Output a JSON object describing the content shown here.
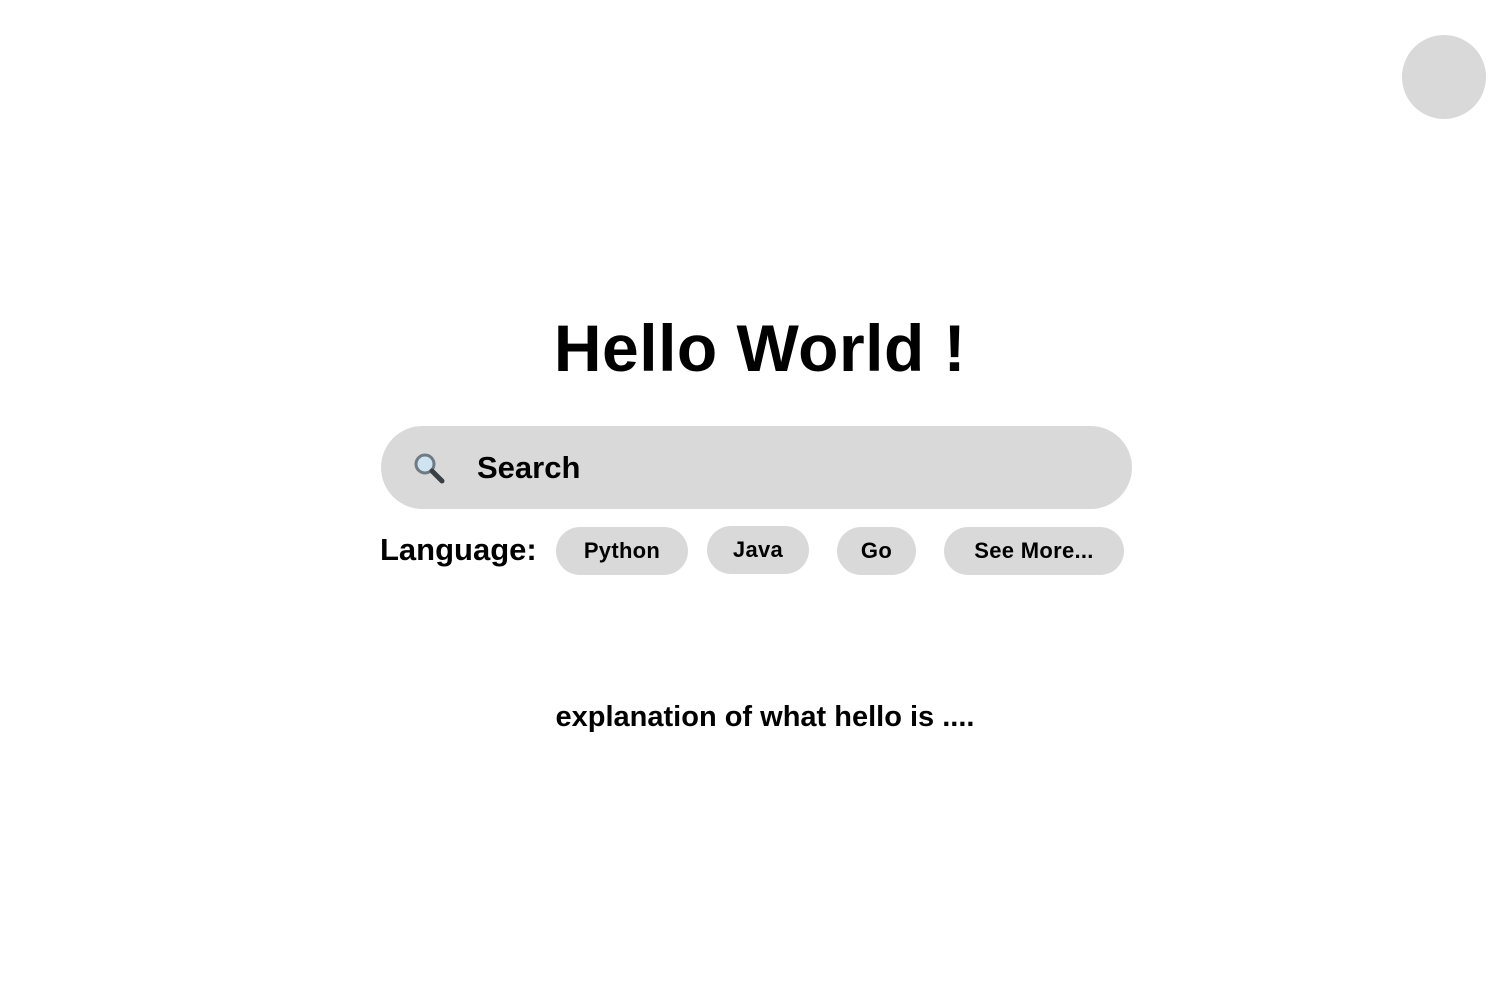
{
  "header": {
    "avatar_label": ""
  },
  "main": {
    "title": "Hello World !",
    "search": {
      "icon": "search-icon",
      "placeholder": "Search",
      "value": ""
    },
    "language": {
      "label": "Language:",
      "options": [
        "Python",
        "Java",
        "Go",
        "See More..."
      ]
    },
    "explanation": "explanation of what hello is ...."
  },
  "colors": {
    "background": "#ffffff",
    "surface": "#d9d9d9",
    "text": "#000000"
  }
}
